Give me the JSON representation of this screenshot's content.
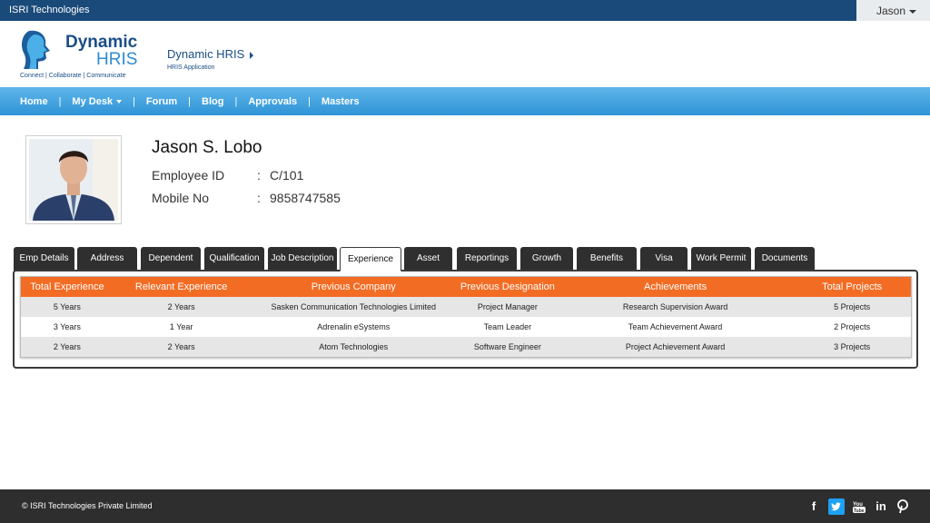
{
  "topbar": {
    "company": "ISRI Technologies",
    "user": "Jason"
  },
  "logo": {
    "line1": "Dynamic",
    "line2": "HRIS",
    "tagline": "Connect | Collaborate | Communicate"
  },
  "app": {
    "name": "Dynamic HRIS",
    "subtitle": "HRIS Application"
  },
  "nav": {
    "items": [
      "Home",
      "My Desk",
      "Forum",
      "Blog",
      "Approvals",
      "Masters"
    ]
  },
  "profile": {
    "name": "Jason S. Lobo",
    "employee_id_label": "Employee ID",
    "employee_id": "C/101",
    "mobile_label": "Mobile No",
    "mobile": "9858747585"
  },
  "tabs": [
    "Emp Details",
    "Address",
    "Dependent",
    "Qualification",
    "Job Description",
    "Experience",
    "Asset",
    "Reportings",
    "Growth",
    "Benefits",
    "Visa",
    "Work Permit",
    "Documents"
  ],
  "active_tab": "Experience",
  "table": {
    "headers": [
      "Total Experience",
      "Relevant Experience",
      "Previous Company",
      "Previous Designation",
      "Achievements",
      "Total Projects"
    ],
    "rows": [
      [
        "5 Years",
        "2 Years",
        "Sasken Communication Technologies Limited",
        "Project Manager",
        "Research Supervision Award",
        "5 Projects"
      ],
      [
        "3 Years",
        "1 Year",
        "Adrenalin eSystems",
        "Team Leader",
        "Team Achievement Award",
        "2 Projects"
      ],
      [
        "2 Years",
        "2 Years",
        "Atom Technologies",
        "Software Engineer",
        "Project Achievement Award",
        "3 Projects"
      ]
    ]
  },
  "footer": {
    "copyright": "© ISRI Technologies Private Limited"
  },
  "social_icons": [
    "facebook-icon",
    "twitter-icon",
    "youtube-icon",
    "linkedin-icon",
    "pinterest-icon"
  ],
  "colors": {
    "topbar": "#1a4a7a",
    "nav": "#2f93d6",
    "accent": "#f36c24",
    "footer": "#2e2e2e"
  }
}
